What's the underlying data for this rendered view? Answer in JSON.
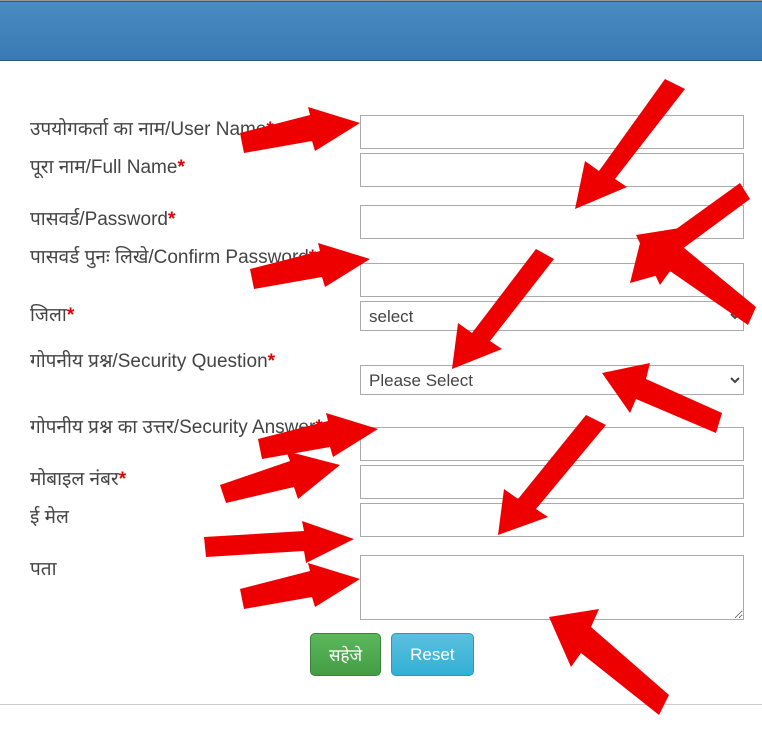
{
  "labels": {
    "username": "उपयोगकर्ता का नाम/User Name",
    "fullname": "पूरा नाम/Full Name",
    "password": "पासवर्ड/Password",
    "confirm": "पासवर्ड पुनः लिखे/Confirm Password",
    "district": "जिला",
    "secq": "गोपनीय प्रश्न/Security Question",
    "seca": "गोपनीय प्रश्न का उत्तर/Security Answer",
    "mobile": "मोबाइल नंबर",
    "email": "ई मेल",
    "address": "पता"
  },
  "required_mark": "*",
  "selects": {
    "district_placeholder": "select",
    "secq_placeholder": "Please Select"
  },
  "buttons": {
    "save": "सहेजे",
    "reset": "Reset"
  }
}
